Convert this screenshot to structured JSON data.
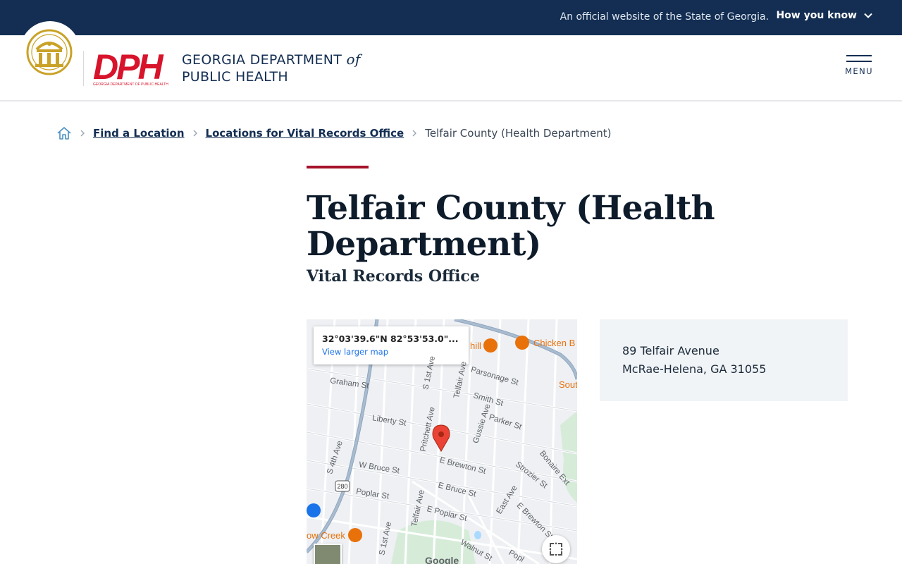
{
  "banner": {
    "official_text": "An official website of the State of Georgia.",
    "how_you_know": "How you know"
  },
  "header": {
    "logo_text": "DPH",
    "logo_caption": "GEORGIA DEPARTMENT OF PUBLIC HEALTH",
    "org_line1_main": "GEORGIA DEPARTMENT",
    "org_line1_of": "of",
    "org_line2": "PUBLIC HEALTH",
    "menu_label": "MENU"
  },
  "breadcrumb": {
    "items": [
      "Find a Location",
      "Locations for Vital Records Office"
    ],
    "current": "Telfair County (Health Department)"
  },
  "page": {
    "title": "Telfair County (Health Department)",
    "subtitle": "Vital Records Office"
  },
  "map": {
    "coords": "32°03'39.6\"N 82°53'53.0\"...",
    "view_larger": "View larger map",
    "streets": {
      "graham": "Graham St",
      "liberty": "Liberty St",
      "s4th": "S 4th Ave",
      "wbruce": "W Bruce St",
      "poplar": "Poplar St",
      "pritchett": "Pritchett Ave",
      "s1st": "S 1st Ave",
      "s1st_lower": "S 1st Ave",
      "telfair": "Telfair Ave",
      "telfair_lower": "Telfair Ave",
      "parsonage": "Parsonage St",
      "smith": "Smith St",
      "gussie": "Gussie Ave",
      "parker": "Parker St",
      "ebrewton": "E Brewton St",
      "ebruce": "E Bruce St",
      "epoplar": "E Poplar St",
      "eastave": "East Ave",
      "strozier": "Strozier St",
      "bonaire": "Bonaire Ext",
      "ebrewton2": "E Brewton St",
      "walnut": "Walnut St",
      "popl": "Popl",
      "route": "280"
    },
    "pois": {
      "chicken": "Chicken B",
      "hill": "hill",
      "sout": "Sout",
      "creek": "ow Creek"
    },
    "google": "Google"
  },
  "address": {
    "line1": "89 Telfair Avenue",
    "line2": "McRae-Helena, GA 31055"
  },
  "colors": {
    "banner_bg": "#132e52",
    "accent_red": "#a5122a",
    "navy": "#132e52",
    "address_bg": "#f1f4f7"
  }
}
